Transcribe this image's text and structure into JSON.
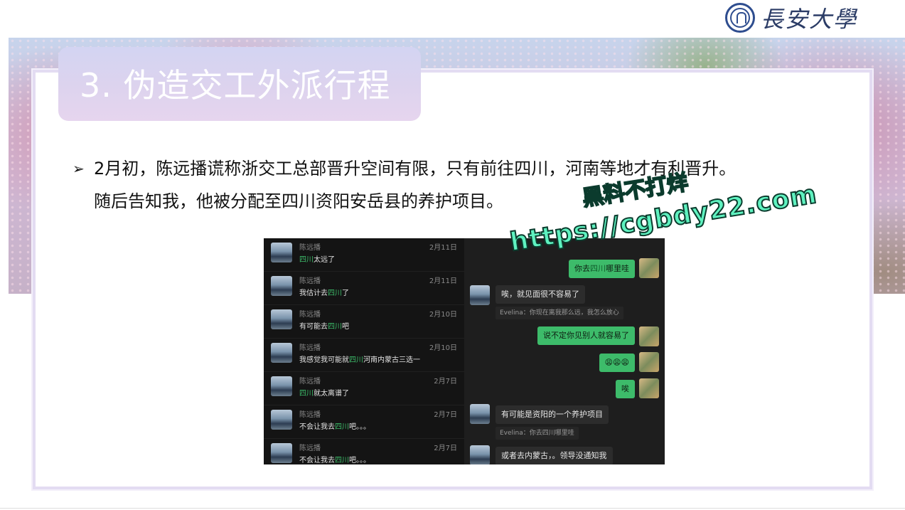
{
  "logo": {
    "text": "長安大學"
  },
  "title": "3. 伪造交工外派行程",
  "body": {
    "line1": "2月初，陈远播谎称浙交工总部晋升空间有限，只有前往四川，河南等地才有利晋升。",
    "line2": "随后告知我，他被分配至四川资阳安岳县的养护项目。"
  },
  "watermark": {
    "line1": "黑料不打烊",
    "line2": "https://cgbdy22.com"
  },
  "chat_list": [
    {
      "name": "陈远播",
      "date": "2月11日",
      "pre": "",
      "hl": "四川",
      "post": "太远了"
    },
    {
      "name": "陈远播",
      "date": "2月11日",
      "pre": "我估计去",
      "hl": "四川",
      "post": "了"
    },
    {
      "name": "陈远播",
      "date": "2月10日",
      "pre": "有可能去",
      "hl": "四川",
      "post": "吧"
    },
    {
      "name": "陈远播",
      "date": "2月10日",
      "pre": "我感觉我可能就",
      "hl": "四川",
      "post": "河南内蒙古三选一"
    },
    {
      "name": "陈远播",
      "date": "2月7日",
      "pre": "",
      "hl": "四川",
      "post": "就太离谱了"
    },
    {
      "name": "陈远播",
      "date": "2月7日",
      "pre": "不会让我去",
      "hl": "四川",
      "post": "吧。。。"
    },
    {
      "name": "陈远播",
      "date": "2月7日",
      "pre": "不会让我去",
      "hl": "四川",
      "post": "吧。。。"
    }
  ],
  "chat_thread": {
    "msg1_pre": "你去",
    "msg1_hl": "四川",
    "msg1_post": "哪里哇",
    "msg2": "唉，就见面很不容易了",
    "quote1": "Evelina：你现在离我那么远，我怎么放心",
    "msg3": "说不定你见别人就容易了",
    "msg4": "😩😩😩",
    "msg5": "唉",
    "msg6": "有可能是资阳的一个养护项目",
    "quote2": "Evelina：你去四川哪里哇",
    "msg7": "或者去内蒙古，。领导没通知我"
  }
}
